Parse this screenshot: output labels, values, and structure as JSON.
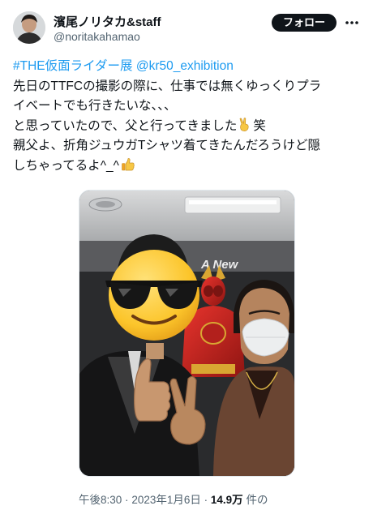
{
  "author": {
    "display_name": "濱尾ノリタカ&staff",
    "handle": "@noritakahamao"
  },
  "follow_button": {
    "label": "フォロー"
  },
  "more_menu": {
    "icon": "more-horizontal-icon"
  },
  "tweet": {
    "hashtag": "#THE仮面ライダー展",
    "mention": "@kr50_exhibition",
    "line2": "先日のTTFCの撮影の際に、仕事では無くゆっくりプラ",
    "line3": "イベートでも行きたいな、、、",
    "line4_pre": "と思っていたので、父と行ってきました",
    "line4_post": "笑",
    "line5": "親父よ、折角ジュウガTシャツ着てきたんだろうけど隠",
    "line6": "しちゃってるよ^_^",
    "emoji_victory": "victory-hand-emoji",
    "emoji_thumbs": "thumbs-up-emoji"
  },
  "photo": {
    "sign_text": "A New"
  },
  "meta": {
    "time": "午後8:30",
    "date": "2023年1月6日",
    "views_count": "14.9万",
    "views_suffix": "件の",
    "separator": "·"
  },
  "colors": {
    "link": "#1d9bf0",
    "text": "#0f1419",
    "muted": "#536471",
    "button_bg": "#0f1419"
  }
}
